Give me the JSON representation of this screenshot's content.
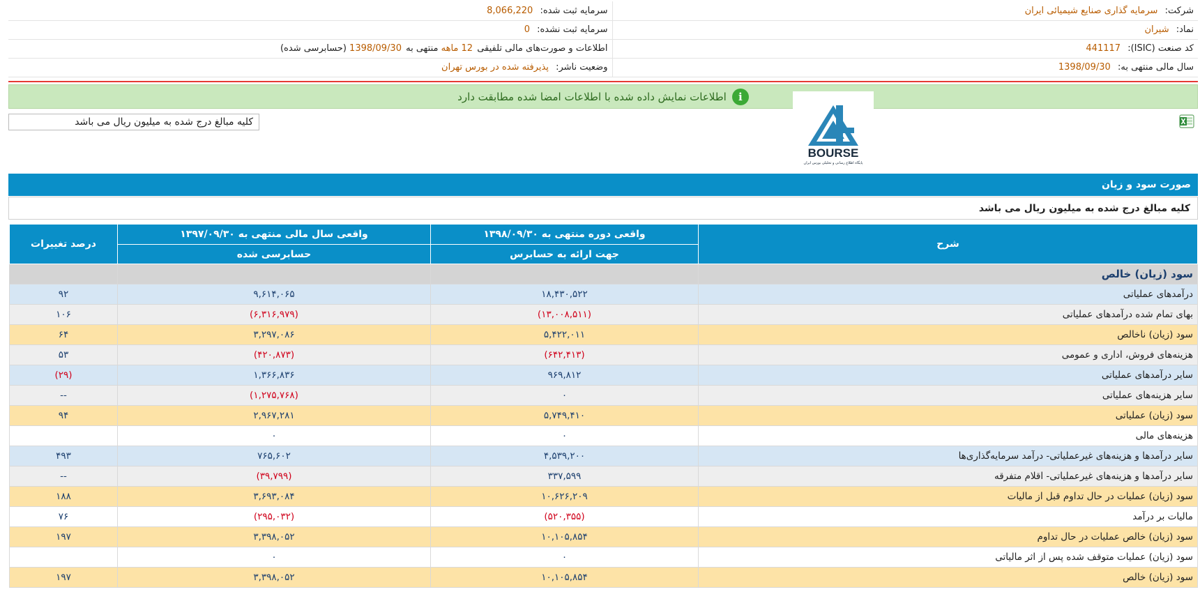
{
  "company_info": {
    "company_label": "شرکت:",
    "company_value": "سرمایه گذاری صنایع شیمیائی ایران",
    "symbol_label": "نماد:",
    "symbol_value": "شیران",
    "isic_label": "کد صنعت (ISIC):",
    "isic_value": "441117",
    "fiscal_label": "سال مالی منتهی به:",
    "fiscal_value": "1398/09/30",
    "reg_capital_label": "سرمایه ثبت شده:",
    "reg_capital_value": "8,066,220",
    "unreg_capital_label": "سرمایه ثبت نشده:",
    "unreg_capital_value": "0",
    "statement_text_1": "اطلاعات و صورت‌های مالی تلفیقی",
    "statement_months": "12 ماهه",
    "statement_text_2": "منتهی به",
    "statement_date": "1398/09/30",
    "statement_text_3": "(حسابرسی شده)",
    "publisher_label": "وضعیت ناشر:",
    "publisher_value": "پذیرفته شده در بورس تهران"
  },
  "banner": {
    "icon": "i",
    "text": "اطلاعات نمایش داده شده با اطلاعات امضا شده مطابقت دارد"
  },
  "logo": {
    "brand": "BOURSE",
    "tagline": "پایگاه اطلاع رسانی و تحلیلی بورس ایران"
  },
  "unit_box": "کلیه مبالغ درج شده به میلیون ریال می باشد",
  "section": {
    "title": "صورت سود و زیان",
    "unit_note": "کلیه مبالغ درج شده به میلیون ریال می باشد"
  },
  "table": {
    "headers": {
      "desc": "شرح",
      "period": "واقعی دوره منتهی به ۱۳۹۸/۰۹/۳۰",
      "period_sub": "جهت ارائه به حسابرس",
      "prev": "واقعی سال مالی منتهی به ۱۳۹۷/۰۹/۳۰",
      "prev_sub": "حسابرسی شده",
      "change": "درصد تغییرات"
    },
    "section_row": "سود (زیان) خالص",
    "rows": [
      {
        "desc": "درآمدهای عملیاتی",
        "current": "۱۸,۴۳۰,۵۲۲",
        "previous": "۹,۶۱۴,۰۶۵",
        "change": "۹۲"
      },
      {
        "desc": "بهای تمام شده درآمدهای عملیاتی",
        "current": "(۱۳,۰۰۸,۵۱۱)",
        "previous": "(۶,۳۱۶,۹۷۹)",
        "change": "۱۰۶"
      },
      {
        "desc": "سود (زیان) ناخالص",
        "current": "۵,۴۲۲,۰۱۱",
        "previous": "۳,۲۹۷,۰۸۶",
        "change": "۶۴"
      },
      {
        "desc": "هزینه‌های فروش، اداری و عمومی",
        "current": "(۶۴۲,۴۱۳)",
        "previous": "(۴۲۰,۸۷۳)",
        "change": "۵۳"
      },
      {
        "desc": "سایر درآمدهای عملیاتی",
        "current": "۹۶۹,۸۱۲",
        "previous": "۱,۳۶۶,۸۳۶",
        "change": "(۲۹)"
      },
      {
        "desc": "سایر هزینه‌های عملیاتی",
        "current": "۰",
        "previous": "(۱,۲۷۵,۷۶۸)",
        "change": "--"
      },
      {
        "desc": "سود (زیان) عملیاتی",
        "current": "۵,۷۴۹,۴۱۰",
        "previous": "۲,۹۶۷,۲۸۱",
        "change": "۹۴"
      },
      {
        "desc": "هزینه‌های مالی",
        "current": "۰",
        "previous": "۰",
        "change": ""
      },
      {
        "desc": "سایر درآمدها و هزینه‌های غیرعملیاتی- درآمد سرمایه‌گذاری‌ها",
        "current": "۴,۵۳۹,۲۰۰",
        "previous": "۷۶۵,۶۰۲",
        "change": "۴۹۳"
      },
      {
        "desc": "سایر درآمدها و هزینه‌های غیرعملیاتی- اقلام متفرقه",
        "current": "۳۳۷,۵۹۹",
        "previous": "(۳۹,۷۹۹)",
        "change": "--"
      },
      {
        "desc": "سود (زیان) عملیات در حال تداوم قبل از مالیات",
        "current": "۱۰,۶۲۶,۲۰۹",
        "previous": "۳,۶۹۳,۰۸۴",
        "change": "۱۸۸"
      },
      {
        "desc": "مالیات بر درآمد",
        "current": "(۵۲۰,۳۵۵)",
        "previous": "(۲۹۵,۰۳۲)",
        "change": "۷۶"
      },
      {
        "desc": "سود (زیان) خالص عملیات در حال تداوم",
        "current": "۱۰,۱۰۵,۸۵۴",
        "previous": "۳,۳۹۸,۰۵۲",
        "change": "۱۹۷"
      },
      {
        "desc": "سود (زیان) عملیات متوقف شده پس از اثر مالیاتی",
        "current": "۰",
        "previous": "۰",
        "change": ""
      },
      {
        "desc": "سود (زیان) خالص",
        "current": "۱۰,۱۰۵,۸۵۴",
        "previous": "۳,۳۹۸,۰۵۲",
        "change": "۱۹۷"
      }
    ]
  },
  "colors": {
    "header_blue": "#0a8fc8",
    "banner_green": "#c9e8bd",
    "row_blue": "#d6e6f4",
    "row_grey": "#eeeeee",
    "row_orange": "#fde3a7",
    "negative_red": "#d0021b",
    "value_orange": "#b85c00",
    "divider_red": "#e53935"
  }
}
